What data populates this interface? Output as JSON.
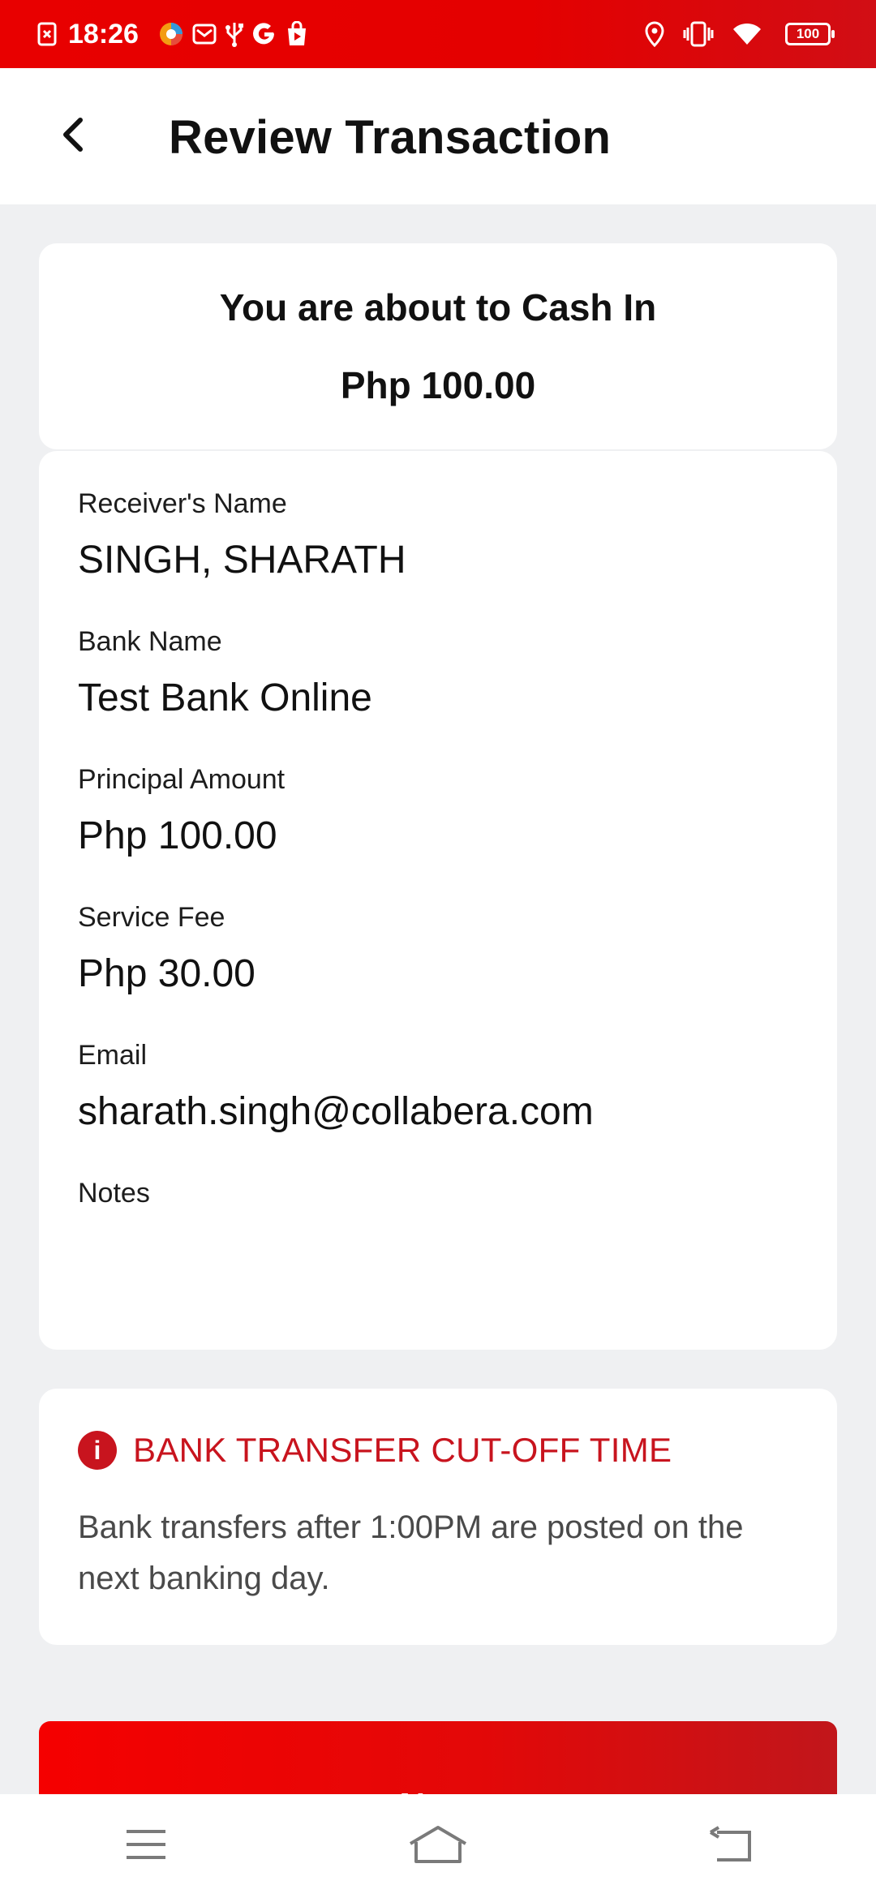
{
  "status_bar": {
    "time": "18:26",
    "battery": "100",
    "left_icons": [
      "sim-error-icon",
      "browser-icon",
      "mail-icon",
      "usb-icon",
      "google-icon",
      "store-icon"
    ],
    "right_icons": [
      "location-icon",
      "vibrate-icon",
      "wifi-icon",
      "battery-icon"
    ]
  },
  "header": {
    "title": "Review Transaction",
    "back_icon": "chevron-left-icon"
  },
  "summary": {
    "title": "You are about to Cash In",
    "amount": "Php 100.00"
  },
  "details": [
    {
      "label": "Receiver's Name",
      "value": "SINGH, SHARATH"
    },
    {
      "label": "Bank Name",
      "value": "Test Bank Online"
    },
    {
      "label": "Principal Amount",
      "value": "Php 100.00"
    },
    {
      "label": "Service Fee",
      "value": "Php 30.00"
    },
    {
      "label": "Email",
      "value": "sharath.singh@collabera.com"
    },
    {
      "label": "Notes",
      "value": ""
    }
  ],
  "notice": {
    "icon": "info-icon",
    "title": "BANK TRANSFER CUT-OFF TIME",
    "body": "Bank transfers after 1:00PM are posted on the next banking day."
  },
  "actions": {
    "next_label": "Next"
  },
  "nav": {
    "icons": [
      "menu-icon",
      "home-icon",
      "back-icon"
    ]
  },
  "colors": {
    "brand_red": "#e40000",
    "notice_red": "#c8141e",
    "background": "#eff0f2"
  }
}
